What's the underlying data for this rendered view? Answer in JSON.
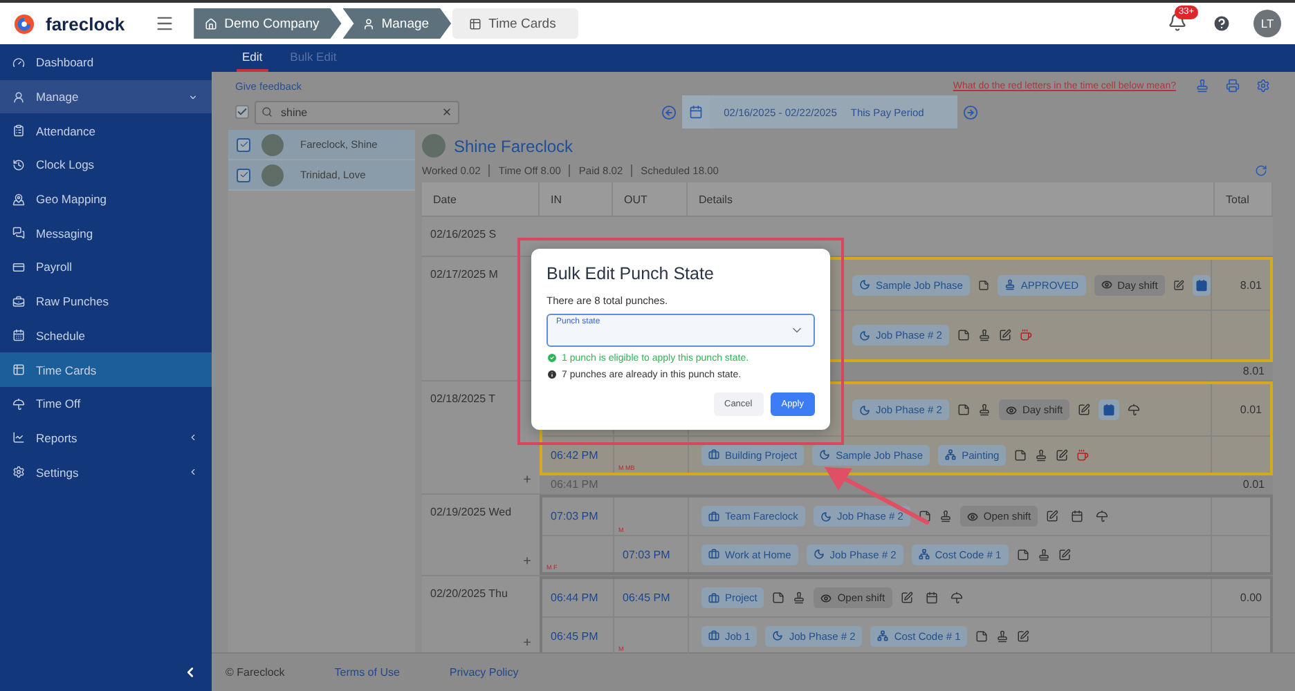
{
  "app": {
    "name": "fareclock"
  },
  "breadcrumb": [
    {
      "label": "Demo Company",
      "selected": false
    },
    {
      "label": "Manage",
      "selected": false
    },
    {
      "label": "Time Cards",
      "selected": true
    }
  ],
  "header": {
    "notifications": "33+",
    "avatar": "LT"
  },
  "sidebar": {
    "items": [
      {
        "label": "Dashboard",
        "selected": false
      },
      {
        "label": "Manage",
        "selected": false,
        "expanded": true
      },
      {
        "label": "Attendance",
        "selected": false
      },
      {
        "label": "Clock Logs",
        "selected": false
      },
      {
        "label": "Geo Mapping",
        "selected": false
      },
      {
        "label": "Messaging",
        "selected": false
      },
      {
        "label": "Payroll",
        "selected": false
      },
      {
        "label": "Raw Punches",
        "selected": false
      },
      {
        "label": "Schedule",
        "selected": false
      },
      {
        "label": "Time Cards",
        "selected": true
      },
      {
        "label": "Time Off",
        "selected": false
      },
      {
        "label": "Reports",
        "selected": false,
        "expanded": false
      },
      {
        "label": "Settings",
        "selected": false,
        "expanded": false
      }
    ]
  },
  "tabs": [
    {
      "label": "Edit",
      "selected": true
    },
    {
      "label": "Bulk Edit",
      "selected": false
    }
  ],
  "employees": {
    "feedback_link": "Give feedback",
    "select_all": {
      "checked": true
    },
    "search": {
      "value": "shine"
    },
    "items": [
      {
        "name": "Fareclock, Shine",
        "checked": true,
        "selected": true
      },
      {
        "name": "Trinidad, Love",
        "checked": true,
        "selected": true
      }
    ]
  },
  "help_link": "What do the red letters in the time cell below mean?",
  "period": {
    "range": "02/16/2025 - 02/22/2025",
    "label": "This Pay Period"
  },
  "employee": {
    "name": "Shine Fareclock",
    "stats": [
      "Worked 0.02",
      "Time Off 8.00",
      "Paid 8.02",
      "Scheduled 18.00"
    ]
  },
  "table": {
    "columns": [
      "Date",
      "IN",
      "OUT",
      "Details",
      "Total"
    ],
    "days": [
      {
        "date": "02/16/2025 S"
      },
      {
        "date": "02/17/2025 M",
        "flagged": true,
        "total": "8.01",
        "punches": [
          {
            "details": [
              {
                "kind": "phase",
                "label": "Sample Job Phase"
              },
              {
                "kind": "note"
              },
              {
                "kind": "status",
                "label": "APPROVED"
              },
              {
                "kind": "shift",
                "label": "Day shift"
              },
              {
                "kind": "edit"
              },
              {
                "kind": "calendar",
                "active": true
              }
            ]
          },
          {
            "details": [
              {
                "kind": "phase",
                "label": "Job Phase # 2"
              },
              {
                "kind": "note"
              },
              {
                "kind": "stamp"
              },
              {
                "kind": "edit"
              },
              {
                "kind": "coffee"
              }
            ]
          }
        ],
        "summary": {
          "total": "8.01"
        }
      },
      {
        "date": "02/18/2025 T",
        "flagged": true,
        "total": "0.01",
        "add": "+",
        "punches": [
          {
            "details": [
              {
                "kind": "phase",
                "label": "Job Phase # 2"
              },
              {
                "kind": "note"
              },
              {
                "kind": "stamp"
              },
              {
                "kind": "shift",
                "label": "Day shift"
              },
              {
                "kind": "edit"
              },
              {
                "kind": "calendar",
                "active": true
              },
              {
                "kind": "umbrella"
              }
            ]
          },
          {
            "in": "06:42 PM",
            "out_flags": "M MB",
            "details": [
              {
                "kind": "job",
                "label": "Building Project"
              },
              {
                "kind": "phase",
                "label": "Sample Job Phase"
              },
              {
                "kind": "cost",
                "label": "Painting"
              },
              {
                "kind": "note"
              },
              {
                "kind": "stamp"
              },
              {
                "kind": "edit"
              },
              {
                "kind": "coffee"
              }
            ]
          }
        ],
        "summary": {
          "in": "06:41 PM",
          "total": "0.01"
        }
      },
      {
        "date": "02/19/2025 Wed",
        "flagged": false,
        "add": "+",
        "punches": [
          {
            "in": "07:03 PM",
            "out_flags": "M",
            "details": [
              {
                "kind": "job",
                "label": "Team Fareclock"
              },
              {
                "kind": "phase",
                "label": "Job Phase # 2"
              },
              {
                "kind": "note"
              },
              {
                "kind": "stamp"
              },
              {
                "kind": "shift",
                "label": "Open shift"
              },
              {
                "kind": "edit"
              },
              {
                "kind": "calendar",
                "active": false
              },
              {
                "kind": "umbrella"
              }
            ]
          },
          {
            "in_flags": "M F",
            "out": "07:03 PM",
            "details": [
              {
                "kind": "job",
                "label": "Work at Home"
              },
              {
                "kind": "phase",
                "label": "Job Phase # 2"
              },
              {
                "kind": "cost",
                "label": "Cost Code # 1"
              },
              {
                "kind": "note"
              },
              {
                "kind": "stamp"
              },
              {
                "kind": "edit"
              }
            ]
          }
        ]
      },
      {
        "date": "02/20/2025 Thu",
        "flagged": false,
        "total": "0.00",
        "add": "+",
        "punches": [
          {
            "in": "06:44 PM",
            "out": "06:45 PM",
            "details": [
              {
                "kind": "job",
                "label": "Project"
              },
              {
                "kind": "note"
              },
              {
                "kind": "stamp"
              },
              {
                "kind": "shift",
                "label": "Open shift"
              },
              {
                "kind": "edit"
              },
              {
                "kind": "calendar",
                "active": false
              },
              {
                "kind": "umbrella"
              }
            ]
          },
          {
            "in": "06:45 PM",
            "out_flags": "M",
            "details": [
              {
                "kind": "job",
                "label": "Job 1"
              },
              {
                "kind": "phase",
                "label": "Job Phase # 2"
              },
              {
                "kind": "cost",
                "label": "Cost Code # 1"
              },
              {
                "kind": "note"
              },
              {
                "kind": "stamp"
              },
              {
                "kind": "edit"
              }
            ]
          }
        ]
      }
    ]
  },
  "dialog": {
    "title": "Bulk Edit Punch State",
    "text": "There are 8 total punches.",
    "select": {
      "placeholder": "Punch state"
    },
    "messages": [
      {
        "kind": "success",
        "text": "1 punch is eligible to apply this punch state."
      },
      {
        "kind": "info",
        "text": "7 punches are already in this punch state."
      }
    ],
    "buttons": [
      {
        "label": "Cancel",
        "kind": "secondary"
      },
      {
        "label": "Apply",
        "kind": "primary"
      }
    ]
  },
  "footer": {
    "copyright": "© Fareclock",
    "links": [
      "Terms of Use",
      "Privacy Policy"
    ]
  }
}
